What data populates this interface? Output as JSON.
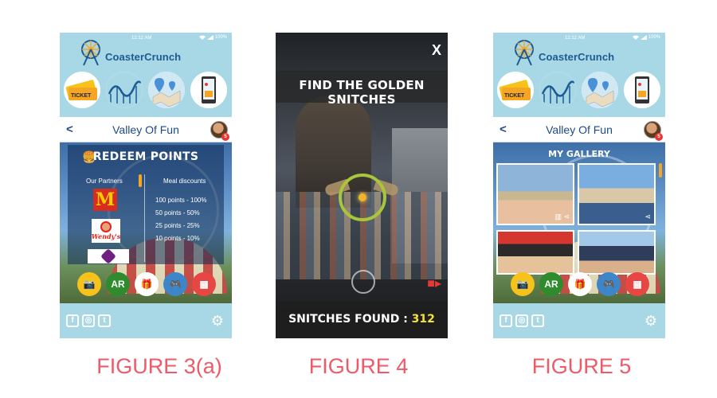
{
  "app": {
    "name": "CoasterCrunch",
    "time": "12:12 AM",
    "battery": "100%"
  },
  "figure_a": {
    "caption": "FIGURE 3(a)",
    "nav": {
      "back": "<",
      "title": "Valley Of Fun",
      "badge": "5"
    },
    "panel": {
      "title": "REDEEM POINTS",
      "partners_header": "Our Partners",
      "meal_header": "Meal discounts",
      "discounts": [
        "100 points - 100%",
        "50 points - 50%",
        "25 points - 25%",
        "10 points - 10%"
      ],
      "partners": [
        "McDonald's",
        "Wendy's",
        "Taco Bell"
      ]
    }
  },
  "figure_b": {
    "caption": "FIGURE 4",
    "close": "X",
    "title": "FIND THE GOLDEN SNITCHES",
    "found_label": "SNITCHES FOUND : ",
    "found_count": "312"
  },
  "figure_c": {
    "caption": "FIGURE 5",
    "nav": {
      "back": "<",
      "title": "Valley Of Fun",
      "badge": "5"
    },
    "gallery_title": "MY GALLERY"
  },
  "actions": [
    "camera-icon",
    "ar-icon",
    "gift-icon",
    "gamepad-icon",
    "grid-icon"
  ],
  "social": [
    "facebook-icon",
    "instagram-icon",
    "twitter-icon"
  ],
  "colors": {
    "header": "#a8d8e6",
    "brand": "#1d5a93",
    "caption": "#ef5a68",
    "accent": "#f5a623"
  }
}
